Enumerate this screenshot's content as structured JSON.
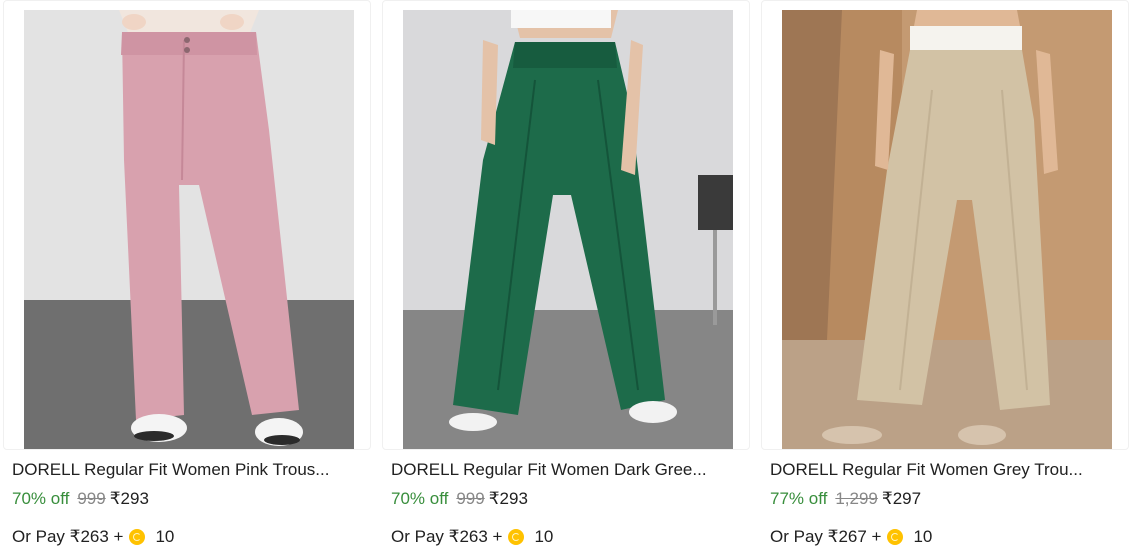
{
  "products": [
    {
      "title": "DORELL Regular Fit Women Pink Trous...",
      "discount": "70% off",
      "mrp": "999",
      "price": "₹293",
      "pay_prefix": "Or Pay ₹263 +",
      "coins": "10",
      "image_icon": "pink-trousers-image",
      "colors": {
        "wall": "#e2e2e2",
        "floor": "#777777",
        "trouser": "#d9a2b0",
        "shoe": "#f4f4f4"
      }
    },
    {
      "title": "DORELL Regular Fit Women Dark Gree...",
      "discount": "70% off",
      "mrp": "999",
      "price": "₹293",
      "pay_prefix": "Or Pay ₹263 +",
      "coins": "10",
      "image_icon": "green-trousers-image",
      "colors": {
        "wall": "#d9d9db",
        "floor": "#8a8a8a",
        "trouser": "#1d6b4a",
        "shoe": "#f2f2f2"
      }
    },
    {
      "title": "DORELL Regular Fit Women Grey Trou...",
      "discount": "77% off",
      "mrp": "1,299",
      "price": "₹297",
      "pay_prefix": "Or Pay ₹267 +",
      "coins": "10",
      "image_icon": "beige-trousers-image",
      "colors": {
        "wall": "#c9a17a",
        "floor": "#b89b7f",
        "trouser": "#d2c2a5",
        "shoe": "#d6c3ad"
      }
    }
  ],
  "theme": {
    "discount_color": "#388e3c",
    "mrp_color": "#878787",
    "coin_color": "#ffc200"
  }
}
